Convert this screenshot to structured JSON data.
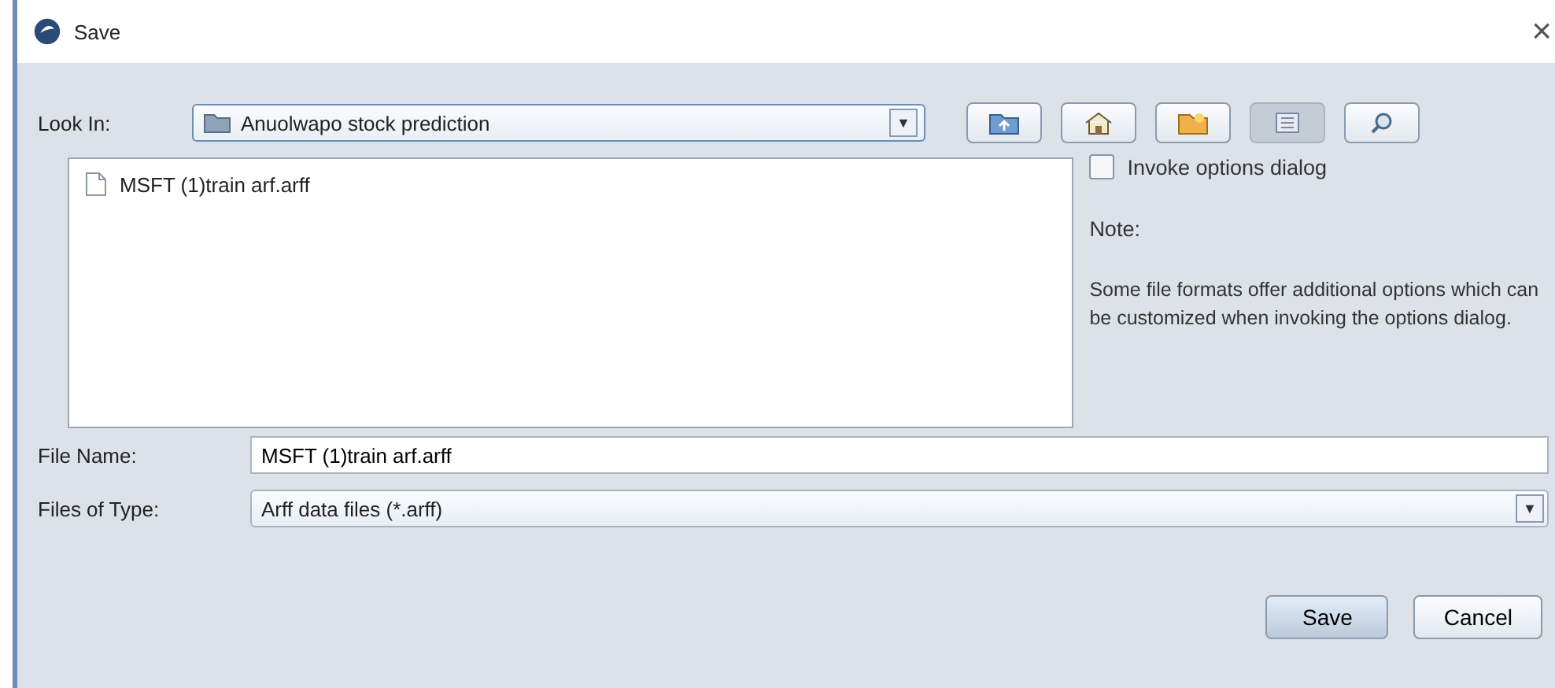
{
  "window": {
    "title": "Save",
    "close": "×"
  },
  "look_in": {
    "label": "Look In:",
    "value": "Anuolwapo stock prediction",
    "arrow": "▼"
  },
  "toolbar": [
    {
      "kind": "up",
      "selected": false
    },
    {
      "kind": "home",
      "selected": false
    },
    {
      "kind": "newfolder",
      "selected": false
    },
    {
      "kind": "list",
      "selected": true
    },
    {
      "kind": "details",
      "selected": false
    }
  ],
  "files": [
    {
      "name": "MSFT (1)train arf.arff",
      "selected": false
    }
  ],
  "options": {
    "checkbox": {
      "label": "Invoke options dialog",
      "checked": false
    },
    "note_title": "Note:",
    "note": "Some file formats offer additional options which can be customized when invoking the options dialog."
  },
  "file_name": {
    "label": "File Name:",
    "value": "MSFT (1)train arf.arff"
  },
  "file_type": {
    "label": "Files of Type:",
    "value": "Arff data files (*.arff)",
    "arrow": "▼"
  },
  "buttons": [
    {
      "label": "Save",
      "default": true
    },
    {
      "label": "Cancel",
      "default": false
    }
  ]
}
